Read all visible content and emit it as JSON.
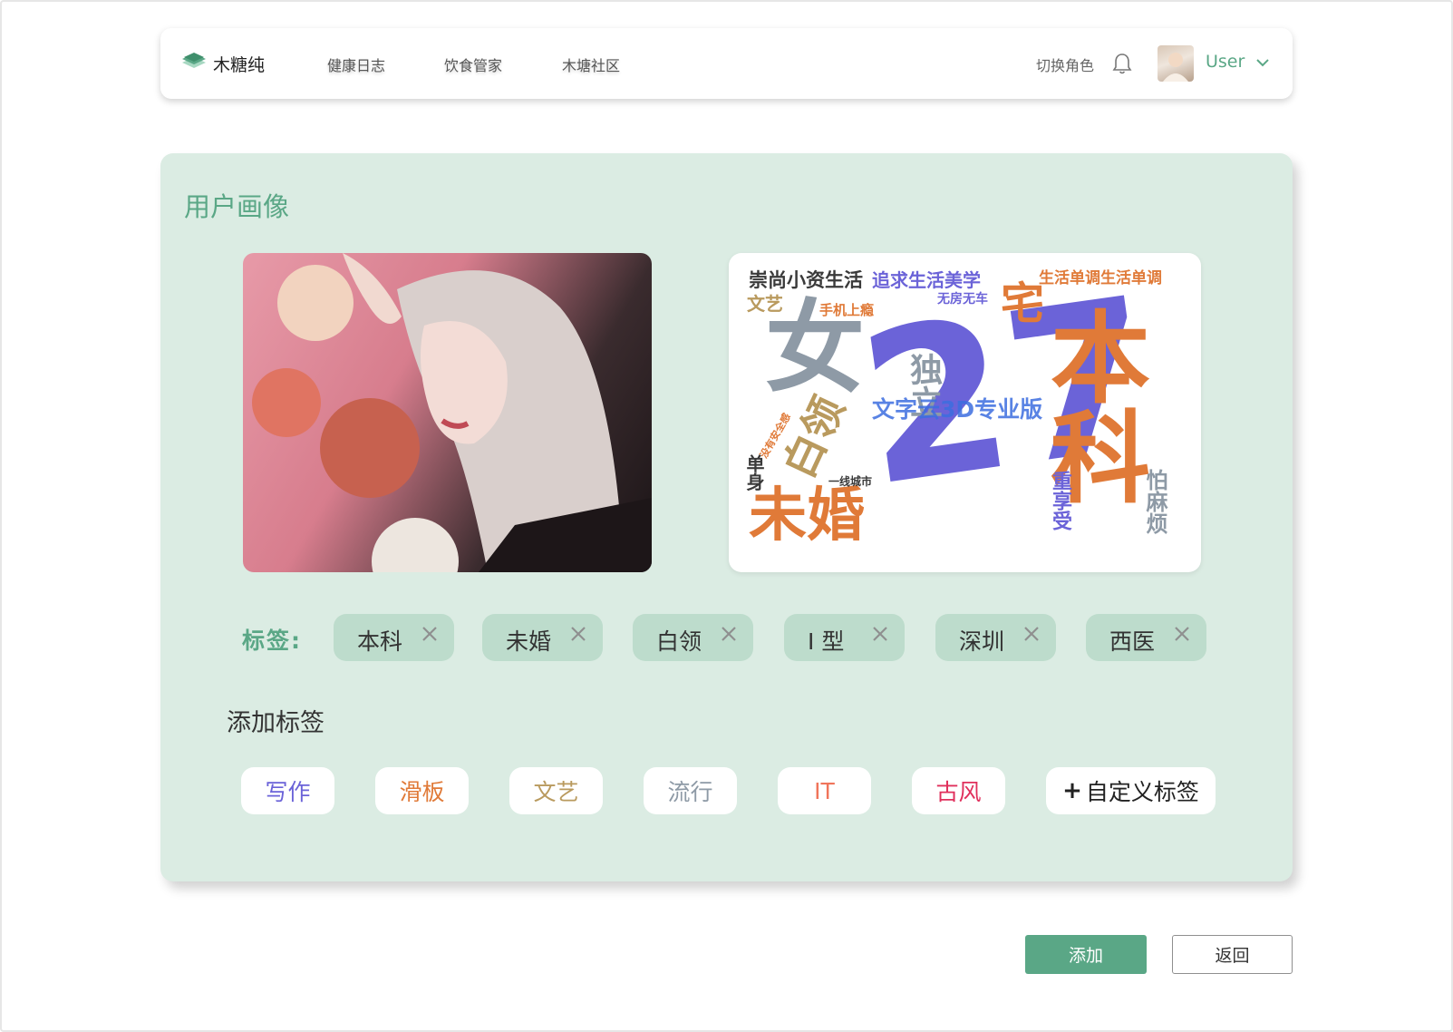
{
  "header": {
    "logo_text": "木糖纯",
    "nav": [
      "健康日志",
      "饮食管家",
      "木塘社区"
    ],
    "switch_role": "切换角色",
    "user_name": "User"
  },
  "card": {
    "title": "用户画像",
    "tags_label": "标签:",
    "tags": [
      "本科",
      "未婚",
      "白领",
      "I 型",
      "深圳",
      "西医"
    ],
    "add_title": "添加标签",
    "suggestions": [
      {
        "label": "写作",
        "color": "#6b63d8"
      },
      {
        "label": "滑板",
        "color": "#e07a38"
      },
      {
        "label": "文艺",
        "color": "#b99a5e"
      },
      {
        "label": "流行",
        "color": "#8e9aa6"
      },
      {
        "label": "IT",
        "color": "#f0745a"
      },
      {
        "label": "古风",
        "color": "#e0305c"
      }
    ],
    "custom_plus": "+",
    "custom_label": "自定义标签"
  },
  "wordcloud": {
    "colors": {
      "purple": "#6b63d8",
      "orange": "#e07a38",
      "gray": "#8e9aa6",
      "tan": "#b99a5e",
      "dark": "#3a3a3a",
      "blue": "#3d6ee0"
    },
    "words": {
      "w27": "27",
      "benke": "本科",
      "nv": "女",
      "weihun": "未婚",
      "bailing": "白领",
      "zhai": "宅",
      "wenyi": "文艺",
      "duli": "独立",
      "danshen": "单身",
      "chongshang": "崇尚小资生活",
      "zhuiqiu": "追求生活美学",
      "shenghuo": "生活单调生活单调",
      "wufang": "无房无车",
      "shouji": "手机上瘾",
      "yixian": "一线城市",
      "pamafan": "怕麻烦",
      "zhongxiang": "重享受",
      "watermark": "文字云3D专业版",
      "meiyou": "没有安全感"
    }
  },
  "actions": {
    "add": "添加",
    "back": "返回"
  }
}
